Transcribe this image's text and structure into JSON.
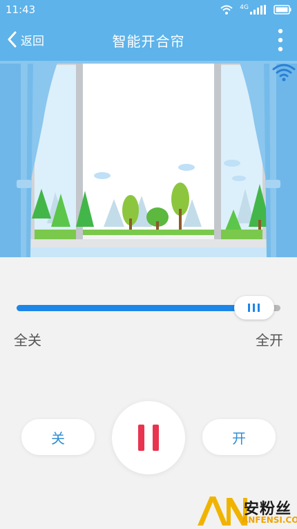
{
  "status_bar": {
    "time": "11:43",
    "network_label": "4G",
    "icons": [
      "wifi-icon",
      "signal-icon",
      "battery-icon"
    ]
  },
  "header": {
    "back_label": "返回",
    "title": "智能开合帘",
    "background_color": "#5db3ea"
  },
  "scene": {
    "icons": [
      "window-frame",
      "curtain-left",
      "curtain-right",
      "trees",
      "clouds",
      "wifi-signal-icon"
    ]
  },
  "curtain_slider": {
    "value_fraction": 0.9,
    "min_label": "全关",
    "max_label": "全开",
    "fill_color": "#1d86e8"
  },
  "buttons": {
    "close_label": "关",
    "open_label": "开",
    "pause_icon": "pause-icon",
    "pause_color": "#e8344e"
  },
  "watermark": {
    "logo_letters": "AN",
    "text": "安粉丝",
    "url": "ANFENSI.COM"
  }
}
